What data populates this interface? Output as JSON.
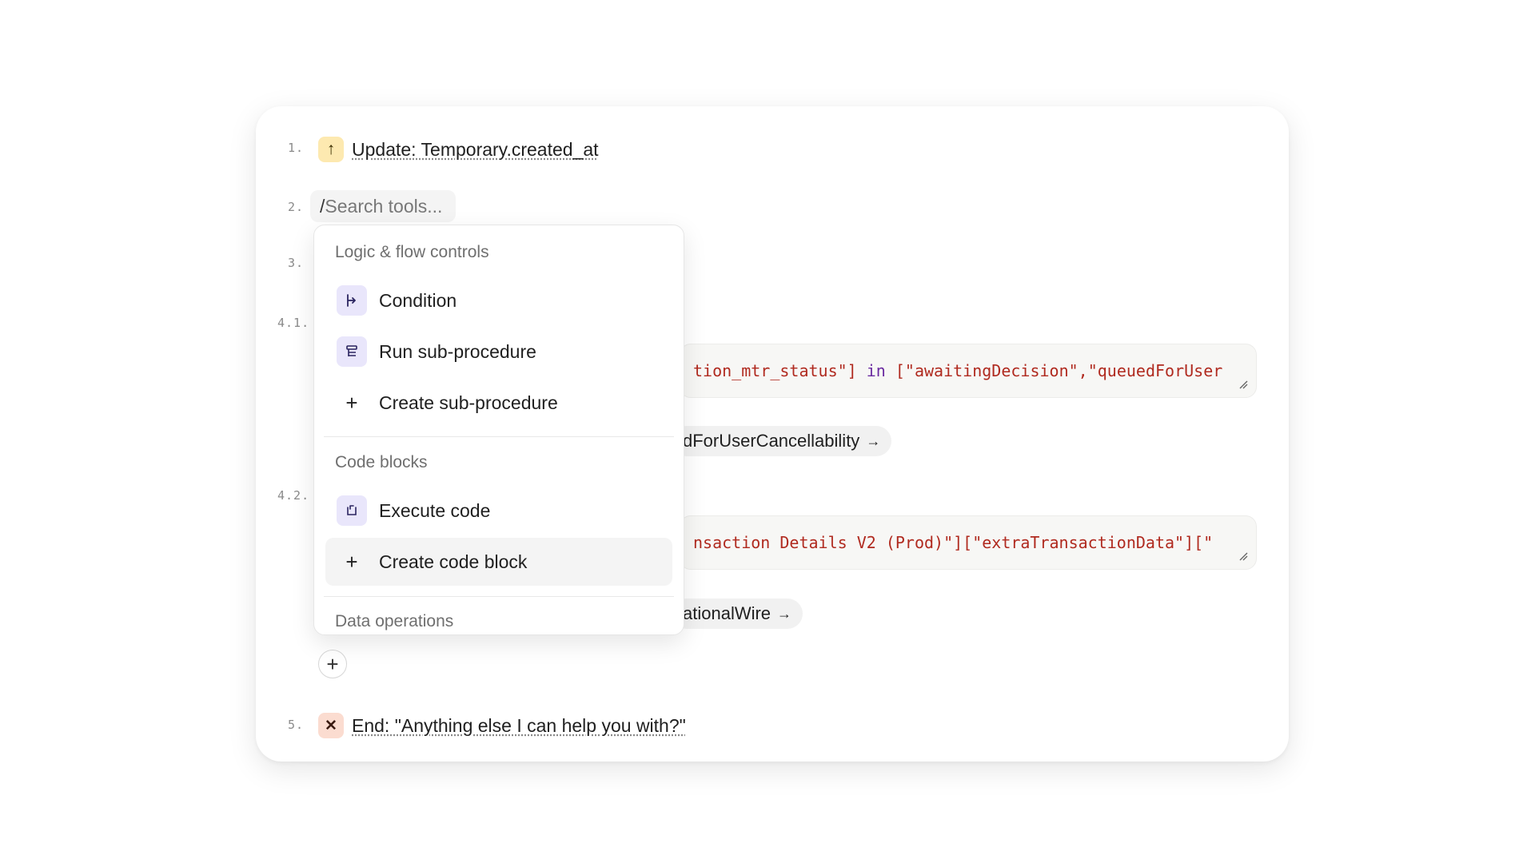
{
  "steps": [
    {
      "number": "1.",
      "label": "Update: Temporary.created_at",
      "icon": "arrow-up-icon"
    },
    {
      "number": "2.",
      "search_slash": "/",
      "search_placeholder": "Search tools..."
    },
    {
      "number": "3."
    },
    {
      "number": "4.1.",
      "code_parts": [
        "tion_mtr_status\"]",
        " in ",
        "[\"awaitingDecision\",\"queuedForUser"
      ],
      "pill": "dForUserCancellability",
      "pill_arrow": "→"
    },
    {
      "number": "4.2.",
      "code_parts": [
        "nsaction Details V2 (Prod)\"][\"extraTransactionData\"][\""
      ],
      "pill": "ationalWire",
      "pill_arrow": "→"
    },
    {
      "number": "5.",
      "label": "End: \"Anything else I can help you with?\"",
      "icon": "close-icon"
    }
  ],
  "add_button": "+",
  "dropdown": {
    "groups": [
      {
        "title": "Logic & flow controls",
        "items": [
          {
            "label": "Condition",
            "icon": "branch-icon"
          },
          {
            "label": "Run sub-procedure",
            "icon": "list-icon"
          },
          {
            "label": "Create sub-procedure",
            "icon": "plus-icon"
          }
        ]
      },
      {
        "title": "Code blocks",
        "items": [
          {
            "label": "Execute code",
            "icon": "code-run-icon"
          },
          {
            "label": "Create code block",
            "icon": "plus-icon",
            "highlighted": true
          }
        ]
      },
      {
        "title": "Data operations",
        "items": []
      }
    ]
  },
  "colors": {
    "accent_icon_bg": "#e9e6fb",
    "update_badge_bg": "#fde9b0",
    "end_badge_bg": "#fbdcd0",
    "code_string": "#b02a1f",
    "code_keyword": "#6a2aa0"
  }
}
